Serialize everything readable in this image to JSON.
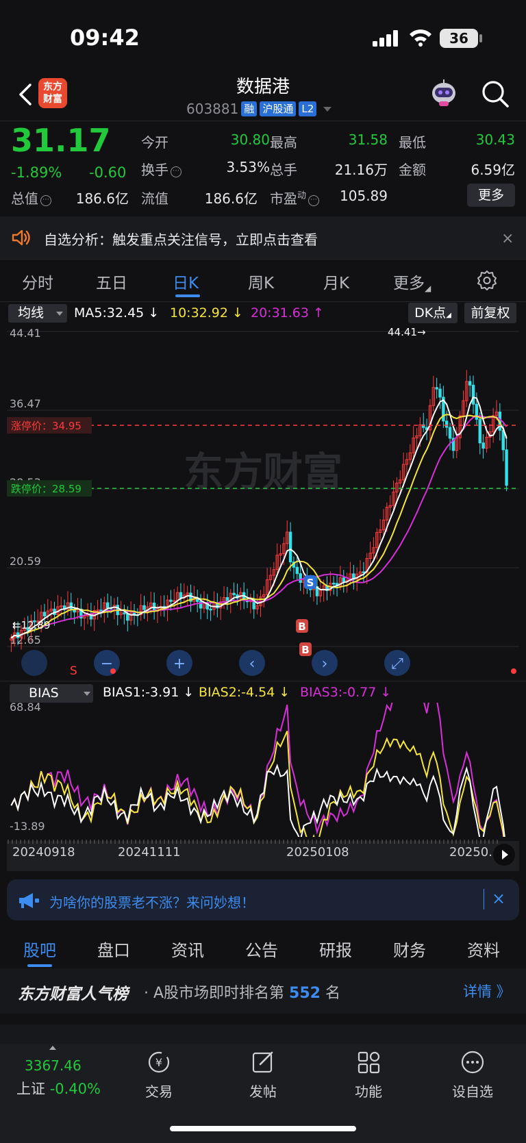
{
  "status": {
    "time": "09:42",
    "battery": "36"
  },
  "header": {
    "logo": [
      "东方",
      "财富"
    ],
    "title": "数据港",
    "code": "603881",
    "tags": [
      "融",
      "沪股通",
      "L2"
    ]
  },
  "quote": {
    "price": "31.17",
    "pct": "-1.89%",
    "change": "-0.60",
    "open_label": "今开",
    "open": "30.80",
    "high_label": "最高",
    "high": "31.58",
    "low_label": "最低",
    "low": "30.43",
    "turnover_label": "换手",
    "turnover": "3.53%",
    "volume_label": "总手",
    "volume": "21.16万",
    "amount_label": "金额",
    "amount": "6.59亿",
    "mcap_label": "总值",
    "mcap": "186.6亿",
    "float_label": "流值",
    "float": "186.6亿",
    "pe_label": "市盈",
    "pe_sup": "动",
    "pe": "105.89",
    "more": "更多"
  },
  "banner": {
    "text": "自选分析：触发重点关注信号，立即点击查看",
    "close": "×"
  },
  "tabs": [
    "分时",
    "五日",
    "日K",
    "周K",
    "月K",
    "更多"
  ],
  "active_tab": "日K",
  "ma": {
    "select": "均线",
    "ma5": "MA5:32.45",
    "ma10": "10:32.92",
    "ma20": "20:31.63",
    "dk": "DK点",
    "adjust": "前复权",
    "colors": {
      "ma5": "#ffffff",
      "ma10": "#f5e53a",
      "ma20": "#d830d8",
      "up": "#ff3b3b",
      "down": "#33e0e8"
    }
  },
  "kline": {
    "y_ticks": [
      "44.41",
      "36.47",
      "28.53",
      "20.59",
      "12.65"
    ],
    "max_label": "44.41→",
    "min_label": "12.89",
    "limit_up_label": "涨停价：34.95",
    "limit_down_label": "跌停价：28.59",
    "watermark": "东方财富",
    "markers": [
      "S",
      "B",
      "B",
      "S"
    ],
    "controls": [
      "minus",
      "plus",
      "left",
      "right",
      "expand"
    ]
  },
  "bias": {
    "select": "BIAS",
    "bias1": "BIAS1:-3.91",
    "bias2": "BIAS2:-4.54",
    "bias3": "BIAS3:-0.77",
    "y_max": "68.84",
    "y_min": "-13.89"
  },
  "date_axis": [
    "20240918",
    "20241111",
    "20250108",
    "20250..."
  ],
  "ad": {
    "text": "为啥你的股票老不涨？来问妙想！",
    "close": "×"
  },
  "lower_tabs": [
    "股吧",
    "盘口",
    "资讯",
    "公告",
    "研报",
    "财务",
    "资料"
  ],
  "rank": {
    "brand": "东方财富人气榜",
    "prefix": "· A股市场即时排名第",
    "rank": "552",
    "suffix": "名",
    "detail": "详情 》"
  },
  "bottom_nav": {
    "index_value": "3367.46",
    "index_name": "上证",
    "index_pct": "-0.40%",
    "items": [
      "交易",
      "发帖",
      "功能",
      "设自选"
    ]
  }
}
